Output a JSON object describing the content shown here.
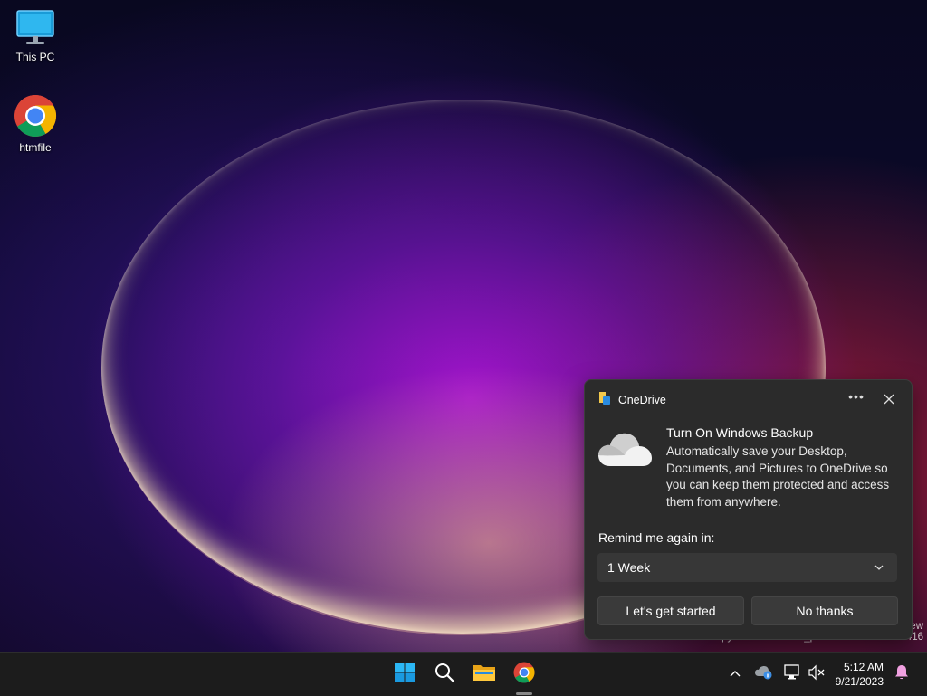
{
  "desktop": {
    "icons": [
      {
        "label": "This PC",
        "icon": "monitor-icon"
      },
      {
        "label": "htmfile",
        "icon": "chrome-icon"
      }
    ],
    "watermark": {
      "line1": "ew",
      "line2": "Evaluation copy. Build 25947.rs_prerelease.230901-1416"
    }
  },
  "notification": {
    "app_name": "OneDrive",
    "more_icon": "ellipsis-icon",
    "close_icon": "close-icon",
    "title": "Turn On Windows Backup",
    "body": "Automatically save your Desktop, Documents, and Pictures to OneDrive so you can keep them protected and access them from anywhere.",
    "remind_label": "Remind me again in:",
    "remind_value": "1 Week",
    "primary_button": "Let's get started",
    "secondary_button": "No thanks"
  },
  "taskbar": {
    "pinned": [
      "start-icon",
      "search-icon",
      "file-explorer-icon",
      "chrome-icon"
    ],
    "tray": [
      "chevron-up-icon",
      "onedrive-icon",
      "network-icon",
      "volume-muted-icon"
    ],
    "time": "5:12 AM",
    "date": "9/21/2023",
    "notification_icon": "bell-icon"
  },
  "colors": {
    "accent": "#0078d4",
    "toast_bg": "#2b2b2b",
    "taskbar_bg": "#1c1c1c",
    "notification_bell": "#f0a0e0"
  }
}
